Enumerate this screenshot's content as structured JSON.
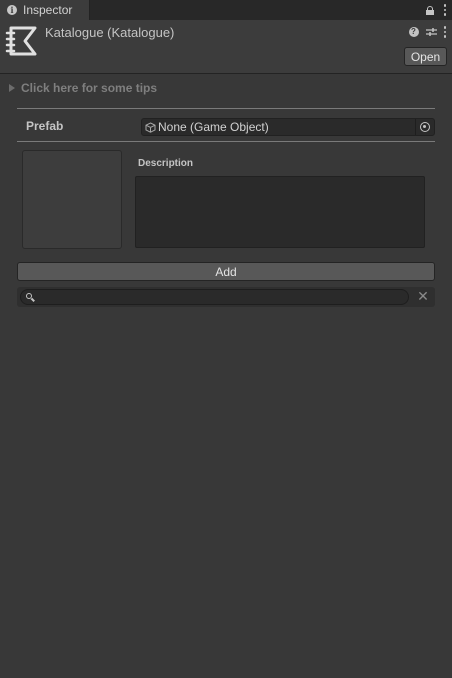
{
  "tab": {
    "title": "Inspector",
    "icon": "info-icon"
  },
  "header": {
    "title": "Katalogue (Katalogue)",
    "icon": "katalogue-asset-icon",
    "open_label": "Open"
  },
  "tips": {
    "label": "Click here for some tips"
  },
  "prefab": {
    "label": "Prefab",
    "value": "None (Game Object)"
  },
  "description": {
    "label": "Description",
    "value": ""
  },
  "add_label": "Add",
  "search": {
    "value": "",
    "placeholder": ""
  },
  "colors": {
    "background": "#383838",
    "header": "#3c3c3c",
    "field": "#2a2a2a",
    "button": "#585858"
  }
}
